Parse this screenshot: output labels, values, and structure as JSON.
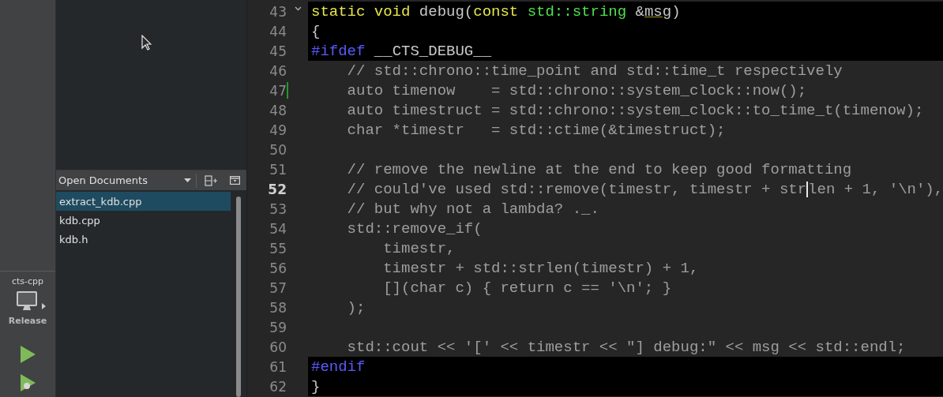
{
  "kit": {
    "project": "cts-cpp",
    "build": "Release"
  },
  "open_documents": {
    "title": "Open Documents",
    "items": [
      {
        "label": "extract_kdb.cpp",
        "selected": true
      },
      {
        "label": "kdb.cpp",
        "selected": false
      },
      {
        "label": "kdb.h",
        "selected": false
      }
    ]
  },
  "editor": {
    "lines": [
      {
        "number": "43",
        "foldable": true,
        "changed": false,
        "current": false,
        "highlighted": true,
        "segments": [
          {
            "kind": "keyword",
            "text": "static void"
          },
          {
            "kind": "text",
            "text": " debug("
          },
          {
            "kind": "keyword",
            "text": "const"
          },
          {
            "kind": "type",
            "text": " std::string"
          },
          {
            "kind": "text",
            "text": " &"
          },
          {
            "kind": "param",
            "text": "msg"
          },
          {
            "kind": "text",
            "text": ")"
          }
        ]
      },
      {
        "number": "44",
        "foldable": false,
        "changed": false,
        "current": false,
        "highlighted": true,
        "segments": [
          {
            "kind": "text",
            "text": "{"
          }
        ]
      },
      {
        "number": "45",
        "foldable": false,
        "changed": false,
        "current": false,
        "highlighted": true,
        "segments": [
          {
            "kind": "preprocessor",
            "text": "#ifdef"
          },
          {
            "kind": "text",
            "text": " __CTS_DEBUG__"
          }
        ]
      },
      {
        "number": "46",
        "foldable": false,
        "changed": false,
        "current": false,
        "highlighted": false,
        "segments": [
          {
            "kind": "text",
            "text": "    // std::chrono::time_point and std::time_t respectively"
          }
        ]
      },
      {
        "number": "47",
        "foldable": false,
        "changed": true,
        "current": false,
        "highlighted": false,
        "segments": [
          {
            "kind": "text",
            "text": "    auto timenow    = std::chrono::system_clock::now();"
          }
        ]
      },
      {
        "number": "48",
        "foldable": false,
        "changed": false,
        "current": false,
        "highlighted": false,
        "segments": [
          {
            "kind": "text",
            "text": "    auto timestruct = std::chrono::system_clock::to_time_t(timenow);"
          }
        ]
      },
      {
        "number": "49",
        "foldable": false,
        "changed": false,
        "current": false,
        "highlighted": false,
        "segments": [
          {
            "kind": "text",
            "text": "    char *timestr   = std::ctime(&timestruct);"
          }
        ]
      },
      {
        "number": "50",
        "foldable": false,
        "changed": false,
        "current": false,
        "highlighted": false
      },
      {
        "number": "51",
        "foldable": false,
        "changed": false,
        "current": false,
        "highlighted": false,
        "segments": [
          {
            "kind": "text",
            "text": "    // remove the newline at the end to keep good formatting"
          }
        ]
      },
      {
        "number": "52",
        "foldable": false,
        "changed": false,
        "current": true,
        "highlighted": false,
        "segments": [
          {
            "kind": "text",
            "text": "    // could've used std::remove(timestr, timestr + str"
          },
          {
            "kind": "cursor"
          },
          {
            "kind": "text",
            "text": "len + 1, '\\n'),"
          }
        ]
      },
      {
        "number": "53",
        "foldable": false,
        "changed": false,
        "current": false,
        "highlighted": false,
        "segments": [
          {
            "kind": "text",
            "text": "    // but why not a lambda? ._."
          }
        ]
      },
      {
        "number": "54",
        "foldable": false,
        "changed": false,
        "current": false,
        "highlighted": false,
        "segments": [
          {
            "kind": "text",
            "text": "    std::remove_if("
          }
        ]
      },
      {
        "number": "55",
        "foldable": false,
        "changed": false,
        "current": false,
        "highlighted": false,
        "segments": [
          {
            "kind": "text",
            "text": "        timestr,"
          }
        ]
      },
      {
        "number": "56",
        "foldable": false,
        "changed": false,
        "current": false,
        "highlighted": false,
        "segments": [
          {
            "kind": "text",
            "text": "        timestr + std::strlen(timestr) + 1,"
          }
        ]
      },
      {
        "number": "57",
        "foldable": false,
        "changed": false,
        "current": false,
        "highlighted": false,
        "segments": [
          {
            "kind": "text",
            "text": "        [](char c) { return c == '\\n'; }"
          }
        ]
      },
      {
        "number": "58",
        "foldable": false,
        "changed": false,
        "current": false,
        "highlighted": false,
        "segments": [
          {
            "kind": "text",
            "text": "    );"
          }
        ]
      },
      {
        "number": "59",
        "foldable": false,
        "changed": false,
        "current": false,
        "highlighted": false
      },
      {
        "number": "60",
        "foldable": false,
        "changed": false,
        "current": false,
        "highlighted": false,
        "segments": [
          {
            "kind": "text",
            "text": "    std::cout << '[' << timestr << \"] debug:\" << msg << std::endl;"
          }
        ]
      },
      {
        "number": "61",
        "foldable": false,
        "changed": false,
        "current": false,
        "highlighted": true,
        "segments": [
          {
            "kind": "preprocessor",
            "text": "#endif"
          }
        ]
      },
      {
        "number": "62",
        "foldable": false,
        "changed": false,
        "current": false,
        "highlighted": true,
        "segments": [
          {
            "kind": "text",
            "text": "}"
          }
        ]
      }
    ]
  }
}
